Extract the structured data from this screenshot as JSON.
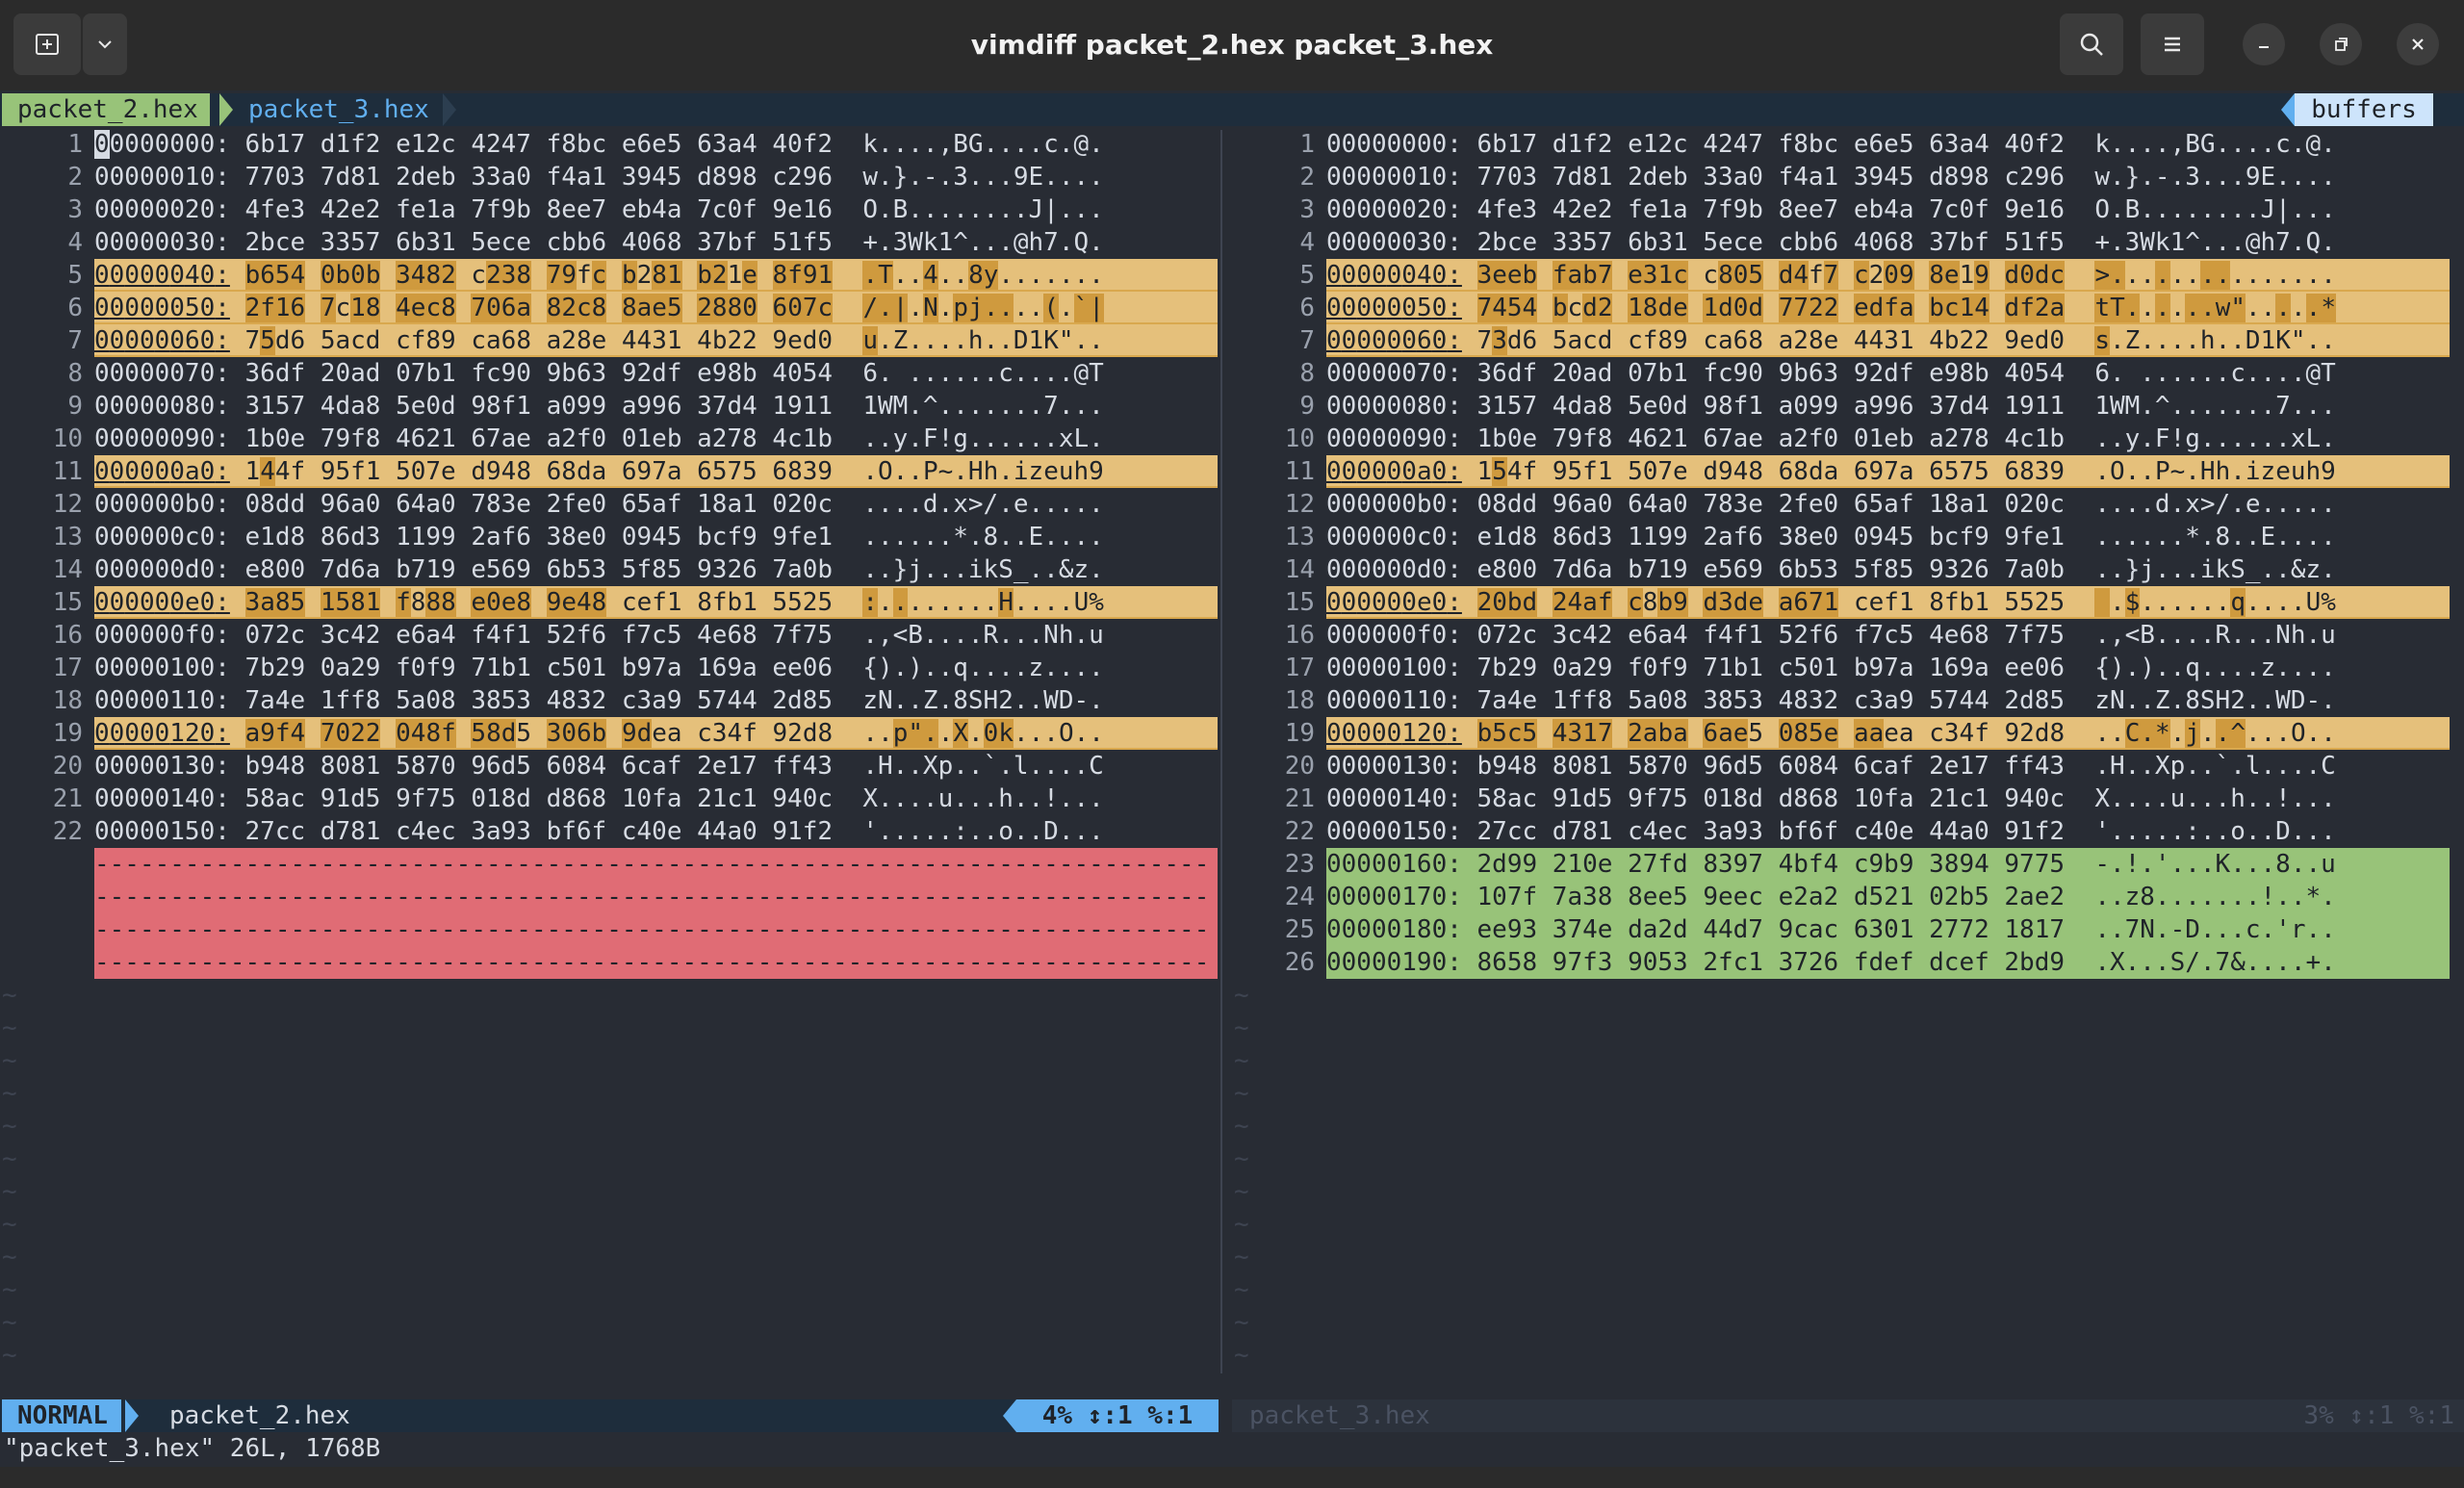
{
  "window": {
    "title": "vimdiff packet_2.hex packet_3.hex",
    "new_tab_icon": "new-tab-icon",
    "dropdown_icon": "chevron-down-icon",
    "search_icon": "search-icon",
    "menu_icon": "hamburger-menu-icon",
    "minimize_icon": "minimize-icon",
    "maximize_icon": "restore-icon",
    "close_icon": "close-icon"
  },
  "tabline": {
    "active_tab": "packet_2.hex",
    "inactive_tab": "packet_3.hex",
    "buffers_label": "buffers"
  },
  "left": {
    "lines": [
      {
        "n": "1",
        "text": "00000000: 6b17 d1f2 e12c 4247 f8bc e6e5 63a4 40f2  k....,BG....c.@.",
        "diff": false
      },
      {
        "n": "2",
        "text": "00000010: 7703 7d81 2deb 33a0 f4a1 3945 d898 c296  w.}.-.3...9E....",
        "diff": false
      },
      {
        "n": "3",
        "text": "00000020: 4fe3 42e2 fe1a 7f9b 8ee7 eb4a 7c0f 9e16  O.B........J|...",
        "diff": false
      },
      {
        "n": "4",
        "text": "00000030: 2bce 3357 6b31 5ece cbb6 4068 37bf 51f5  +.3Wk1^...@h7.Q.",
        "diff": false
      },
      {
        "n": "5",
        "text": "00000040: b654 0b0b 3482 c238 79fc b281 b21e 8f91  .T..4..8y.......",
        "diff": true
      },
      {
        "n": "6",
        "text": "00000050: 2f16 7c18 4ec8 706a 82c8 8ae5 2880 607c  /.|.N.pj....(.`|",
        "diff": true
      },
      {
        "n": "7",
        "text": "00000060: 75d6 5acd cf89 ca68 a28e 4431 4b22 9ed0  u.Z....h..D1K\"..",
        "diff": true
      },
      {
        "n": "8",
        "text": "00000070: 36df 20ad 07b1 fc90 9b63 92df e98b 4054  6. ......c....@T",
        "diff": false
      },
      {
        "n": "9",
        "text": "00000080: 3157 4da8 5e0d 98f1 a099 a996 37d4 1911  1WM.^.......7...",
        "diff": false
      },
      {
        "n": "10",
        "text": "00000090: 1b0e 79f8 4621 67ae a2f0 01eb a278 4c1b  ..y.F!g......xL.",
        "diff": false
      },
      {
        "n": "11",
        "text": "000000a0: 144f 95f1 507e d948 68da 697a 6575 6839  .O..P~.Hh.izeuh9",
        "diff": true
      },
      {
        "n": "12",
        "text": "000000b0: 08dd 96a0 64a0 783e 2fe0 65af 18a1 020c  ....d.x>/.e.....",
        "diff": false
      },
      {
        "n": "13",
        "text": "000000c0: e1d8 86d3 1199 2af6 38e0 0945 bcf9 9fe1  ......*.8..E....",
        "diff": false
      },
      {
        "n": "14",
        "text": "000000d0: e800 7d6a b719 e569 6b53 5f85 9326 7a0b  ..}j...ikS_..&z.",
        "diff": false
      },
      {
        "n": "15",
        "text": "000000e0: 3a85 1581 f888 e0e8 9e48 cef1 8fb1 5525  :........H....U%",
        "diff": true
      },
      {
        "n": "16",
        "text": "000000f0: 072c 3c42 e6a4 f4f1 52f6 f7c5 4e68 7f75  .,<B....R...Nh.u",
        "diff": false
      },
      {
        "n": "17",
        "text": "00000100: 7b29 0a29 f0f9 71b1 c501 b97a 169a ee06  {).)..q....z....",
        "diff": false
      },
      {
        "n": "18",
        "text": "00000110: 7a4e 1ff8 5a08 3853 4832 c3a9 5744 2d85  zN..Z.8SH2..WD-.",
        "diff": false
      },
      {
        "n": "19",
        "text": "00000120: a9f4 7022 048f 58d5 306b 9dea c34f 92d8  ..p\"..X.0k...O..",
        "diff": true
      },
      {
        "n": "20",
        "text": "00000130: b948 8081 5870 96d5 6084 6caf 2e17 ff43  .H..Xp..`.l....C",
        "diff": false
      },
      {
        "n": "21",
        "text": "00000140: 58ac 91d5 9f75 018d d868 10fa 21c1 940c  X....u...h..!...",
        "diff": false
      },
      {
        "n": "22",
        "text": "00000150: 27cc d781 c4ec 3a93 bf6f c40e 44a0 91f2  '.....:..o..D...",
        "diff": false
      }
    ],
    "filler": "-------------------------------------------------------------------------------"
  },
  "right": {
    "lines": [
      {
        "n": "1",
        "text": "00000000: 6b17 d1f2 e12c 4247 f8bc e6e5 63a4 40f2  k....,BG....c.@.",
        "diff": false
      },
      {
        "n": "2",
        "text": "00000010: 7703 7d81 2deb 33a0 f4a1 3945 d898 c296  w.}.-.3...9E....",
        "diff": false
      },
      {
        "n": "3",
        "text": "00000020: 4fe3 42e2 fe1a 7f9b 8ee7 eb4a 7c0f 9e16  O.B........J|...",
        "diff": false
      },
      {
        "n": "4",
        "text": "00000030: 2bce 3357 6b31 5ece cbb6 4068 37bf 51f5  +.3Wk1^...@h7.Q.",
        "diff": false
      },
      {
        "n": "5",
        "text": "00000040: 3eeb fab7 e31c c805 d4f7 c209 8e19 d0dc  >...............",
        "diff": true
      },
      {
        "n": "6",
        "text": "00000050: 7454 bcd2 18de 1d0d 7722 edfa bc14 df2a  tT......w\".....*",
        "diff": true
      },
      {
        "n": "7",
        "text": "00000060: 73d6 5acd cf89 ca68 a28e 4431 4b22 9ed0  s.Z....h..D1K\"..",
        "diff": true
      },
      {
        "n": "8",
        "text": "00000070: 36df 20ad 07b1 fc90 9b63 92df e98b 4054  6. ......c....@T",
        "diff": false
      },
      {
        "n": "9",
        "text": "00000080: 3157 4da8 5e0d 98f1 a099 a996 37d4 1911  1WM.^.......7...",
        "diff": false
      },
      {
        "n": "10",
        "text": "00000090: 1b0e 79f8 4621 67ae a2f0 01eb a278 4c1b  ..y.F!g......xL.",
        "diff": false
      },
      {
        "n": "11",
        "text": "000000a0: 154f 95f1 507e d948 68da 697a 6575 6839  .O..P~.Hh.izeuh9",
        "diff": true
      },
      {
        "n": "12",
        "text": "000000b0: 08dd 96a0 64a0 783e 2fe0 65af 18a1 020c  ....d.x>/.e.....",
        "diff": false
      },
      {
        "n": "13",
        "text": "000000c0: e1d8 86d3 1199 2af6 38e0 0945 bcf9 9fe1  ......*.8..E....",
        "diff": false
      },
      {
        "n": "14",
        "text": "000000d0: e800 7d6a b719 e569 6b53 5f85 9326 7a0b  ..}j...ikS_..&z.",
        "diff": false
      },
      {
        "n": "15",
        "text": "000000e0: 20bd 24af c8b9 d3de a671 cef1 8fb1 5525   .$......q....U%",
        "diff": true
      },
      {
        "n": "16",
        "text": "000000f0: 072c 3c42 e6a4 f4f1 52f6 f7c5 4e68 7f75  .,<B....R...Nh.u",
        "diff": false
      },
      {
        "n": "17",
        "text": "00000100: 7b29 0a29 f0f9 71b1 c501 b97a 169a ee06  {).)..q....z....",
        "diff": false
      },
      {
        "n": "18",
        "text": "00000110: 7a4e 1ff8 5a08 3853 4832 c3a9 5744 2d85  zN..Z.8SH2..WD-.",
        "diff": false
      },
      {
        "n": "19",
        "text": "00000120: b5c5 4317 2aba 6ae5 085e aaea c34f 92d8  ..C.*.j..^...O..",
        "diff": true
      },
      {
        "n": "20",
        "text": "00000130: b948 8081 5870 96d5 6084 6caf 2e17 ff43  .H..Xp..`.l....C",
        "diff": false
      },
      {
        "n": "21",
        "text": "00000140: 58ac 91d5 9f75 018d d868 10fa 21c1 940c  X....u...h..!...",
        "diff": false
      },
      {
        "n": "22",
        "text": "00000150: 27cc d781 c4ec 3a93 bf6f c40e 44a0 91f2  '.....:..o..D...",
        "diff": false
      },
      {
        "n": "23",
        "text": "00000160: 2d99 210e 27fd 8397 4bf4 c9b9 3894 9775  -.!.'...K...8..u",
        "added": true
      },
      {
        "n": "24",
        "text": "00000170: 107f 7a38 8ee5 9eec e2a2 d521 02b5 2ae2  ..z8.......!..*.",
        "added": true
      },
      {
        "n": "25",
        "text": "00000180: ee93 374e da2d 44d7 9cac 6301 2772 1817  ..7N.-D...c.'r..",
        "added": true
      },
      {
        "n": "26",
        "text": "00000190: 8658 97f3 9053 2fc1 3726 fdef dcef 2bd9  .X...S/.7&....+.",
        "added": true
      }
    ]
  },
  "statusline": {
    "mode": "NORMAL",
    "left_file": "packet_2.hex",
    "left_pos": "4%  ↕:1 %:1",
    "right_file": "packet_3.hex",
    "right_pos": "3%  ↕:1 %:1"
  },
  "cmdline": "\"packet_3.hex\" 26L, 1768B",
  "colors": {
    "background": "#282c34",
    "diff_change": "#e5c07b",
    "diff_delete": "#e06c75",
    "diff_add": "#98c379",
    "accent": "#61afef"
  }
}
